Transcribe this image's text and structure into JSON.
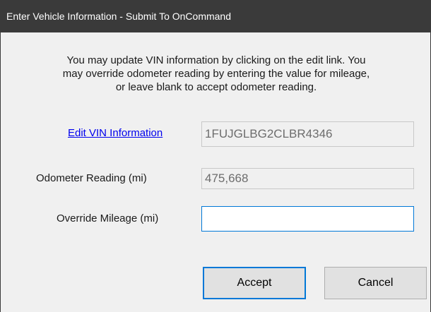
{
  "window": {
    "title": "Enter Vehicle Information - Submit To OnCommand"
  },
  "message": {
    "line1": "You may update VIN information by clicking on the edit link. You",
    "line2": "may override odometer reading by entering the value for mileage,",
    "line3": "or leave blank to accept odometer reading."
  },
  "vin": {
    "link_label": "Edit VIN Information",
    "value": "1FUJGLBG2CLBR4346"
  },
  "odometer": {
    "label": "Odometer Reading (mi)",
    "value": "475,668"
  },
  "override": {
    "label": "Override Mileage (mi)",
    "value": ""
  },
  "buttons": {
    "accept_label": "Accept",
    "cancel_label": "Cancel"
  },
  "colors": {
    "titlebar": "#3a3a3a",
    "link": "#0000ee",
    "focus_border": "#0078d7",
    "dialog_background": "#f0f0f0"
  }
}
